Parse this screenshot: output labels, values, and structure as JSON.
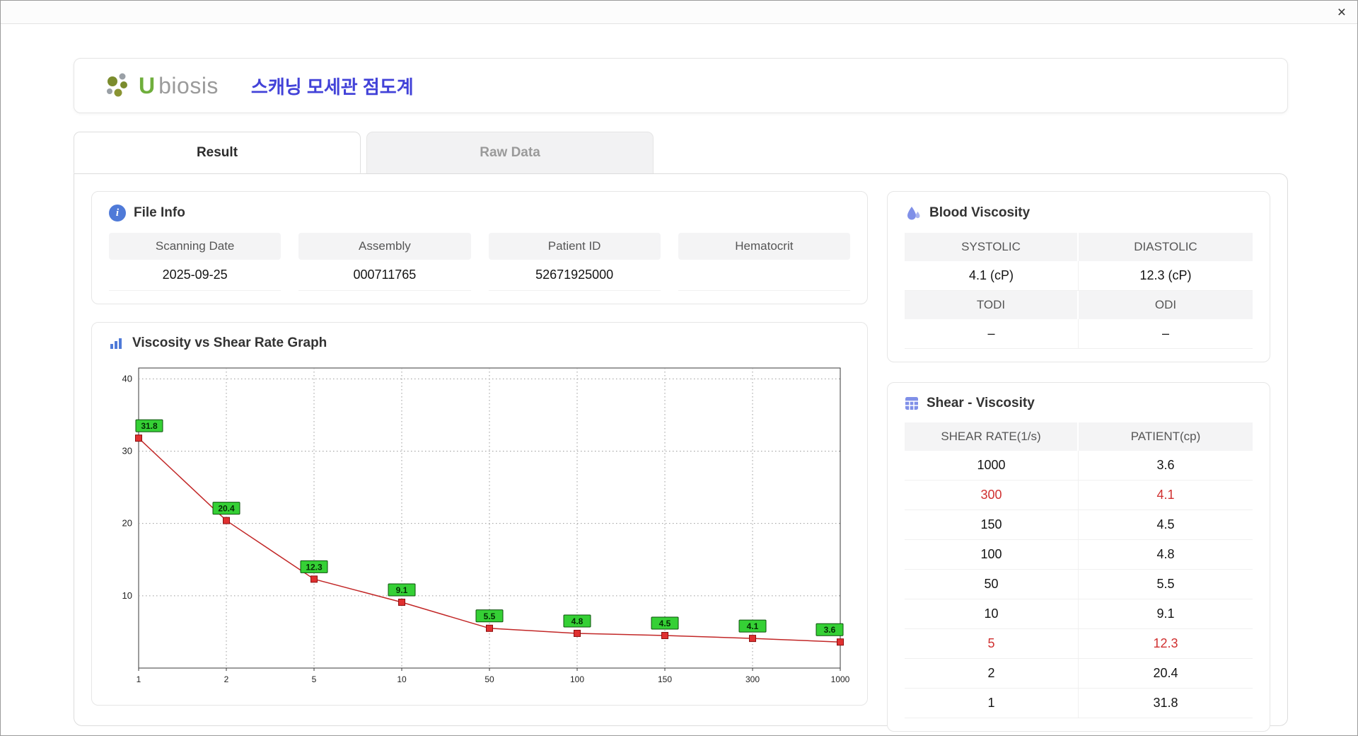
{
  "window": {
    "close_label": "×"
  },
  "colors": {
    "accent_blue": "#4242d8",
    "icon_blue": "#4f7ad8",
    "icon_indigo": "#8090e8",
    "logo_green": "#6fae3c",
    "logo_gray": "#9b9b9b",
    "highlight_red": "#d03030"
  },
  "icons": {
    "info_glyph": "i"
  },
  "header": {
    "logo_u": "U",
    "logo_rest": "biosis",
    "app_title": "스캐닝 모세관 점도계"
  },
  "tabs": [
    {
      "label": "Result",
      "active": true
    },
    {
      "label": "Raw Data",
      "active": false
    }
  ],
  "file_info": {
    "title": "File Info",
    "fields": [
      {
        "label": "Scanning Date",
        "value": "2025-09-25"
      },
      {
        "label": "Assembly",
        "value": "000711765"
      },
      {
        "label": "Patient ID",
        "value": "52671925000"
      },
      {
        "label": "Hematocrit",
        "value": ""
      }
    ]
  },
  "graph": {
    "title": "Viscosity vs Shear Rate Graph"
  },
  "chart_data": {
    "type": "line",
    "title": "Viscosity vs Shear Rate Graph",
    "xlabel": "",
    "ylabel": "",
    "x_scale": "categorical (log-spaced shear rates)",
    "x": [
      1,
      2,
      5,
      10,
      50,
      100,
      150,
      300,
      1000
    ],
    "x_ticks": [
      "1",
      "2",
      "5",
      "10",
      "50",
      "100",
      "150",
      "300",
      "1000"
    ],
    "values": [
      31.8,
      20.4,
      12.3,
      9.1,
      5.5,
      4.8,
      4.5,
      4.1,
      3.6
    ],
    "point_labels": [
      "31.8",
      "20.4",
      "12.3",
      "9.1",
      "5.5",
      "4.8",
      "4.5",
      "4.1",
      "3.6"
    ],
    "y_ticks": [
      10,
      20,
      30,
      40
    ],
    "ylim": [
      0,
      41.5
    ],
    "grid": true,
    "marker": "square",
    "line_color": "#c22727",
    "marker_color": "#e03030",
    "marker_edge": "#8b0e0e",
    "label_bg": "#35d035",
    "label_edge": "#0c4f0c"
  },
  "blood_viscosity": {
    "title": "Blood Viscosity",
    "groups": [
      {
        "headers": [
          "SYSTOLIC",
          "DIASTOLIC"
        ],
        "values": [
          "4.1 (cP)",
          "12.3 (cP)"
        ]
      },
      {
        "headers": [
          "TODI",
          "ODI"
        ],
        "values": [
          "–",
          "–"
        ]
      }
    ]
  },
  "shear_viscosity": {
    "title": "Shear - Viscosity",
    "columns": [
      "SHEAR RATE(1/s)",
      "PATIENT(cp)"
    ],
    "rows": [
      {
        "shear": "1000",
        "patient": "3.6",
        "highlight": false
      },
      {
        "shear": "300",
        "patient": "4.1",
        "highlight": true
      },
      {
        "shear": "150",
        "patient": "4.5",
        "highlight": false
      },
      {
        "shear": "100",
        "patient": "4.8",
        "highlight": false
      },
      {
        "shear": "50",
        "patient": "5.5",
        "highlight": false
      },
      {
        "shear": "10",
        "patient": "9.1",
        "highlight": false
      },
      {
        "shear": "5",
        "patient": "12.3",
        "highlight": true
      },
      {
        "shear": "2",
        "patient": "20.4",
        "highlight": false
      },
      {
        "shear": "1",
        "patient": "31.8",
        "highlight": false
      }
    ]
  }
}
